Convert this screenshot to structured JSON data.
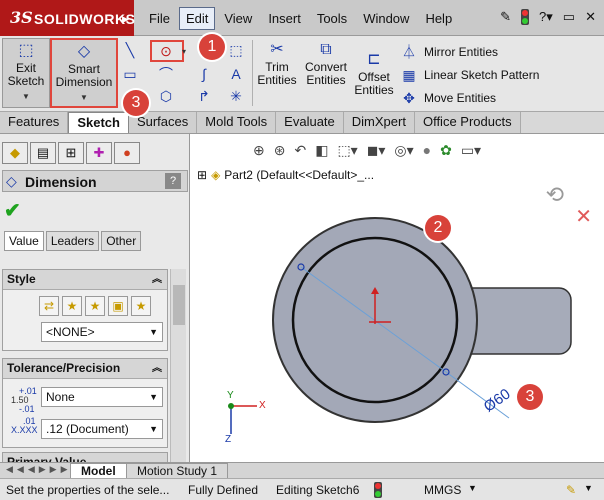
{
  "app": {
    "logo_prefix": "3S",
    "logo_name": "SOLIDWORKS"
  },
  "menu": [
    "File",
    "Edit",
    "View",
    "Insert",
    "Tools",
    "Window",
    "Help"
  ],
  "command_manager": {
    "exit_sketch": "Exit Sketch",
    "smart_dimension": "Smart Dimension",
    "trim_entities": "Trim Entities",
    "convert_entities": "Convert Entities",
    "offset_entities": "Offset Entities",
    "mirror_entities": "Mirror Entities",
    "linear_sketch_pattern": "Linear Sketch Pattern",
    "move_entities": "Move Entities"
  },
  "tabs": [
    "Features",
    "Sketch",
    "Surfaces",
    "Mold Tools",
    "Evaluate",
    "DimXpert",
    "Office Products"
  ],
  "active_tab": "Sketch",
  "property_manager": {
    "title": "Dimension",
    "help": "?",
    "subtabs": [
      "Value",
      "Leaders",
      "Other"
    ],
    "style_group": "Style",
    "style_value": "<NONE>",
    "tolerance_group": "Tolerance/Precision",
    "tolerance_value": "None",
    "tolerance_icon_top": "1.50",
    "tolerance_icon_sup": "+.01",
    "tolerance_icon_sub": "-.01",
    "precision_icon_sup": ".01",
    "precision_icon_main": "X.XXX",
    "precision_value": ".12 (Document)",
    "primary_value_group": "Primary Value"
  },
  "graphics": {
    "tree_label": "Part2  (Default<<Default>_...",
    "dimension_label": "Ø60",
    "axis_x": "X",
    "axis_y": "Y",
    "axis_z": "Z"
  },
  "badges": [
    "1",
    "2",
    "3",
    "3"
  ],
  "bottom_tabs": [
    "Model",
    "Motion Study 1"
  ],
  "status": {
    "message": "Set the properties of the sele...",
    "definition": "Fully Defined",
    "editing": "Editing Sketch6",
    "units": "MMGS"
  },
  "colors": {
    "highlight": "#e0463c",
    "brand": "#b01818",
    "part_fill": "#a3a8b7",
    "sketch_blue": "#1a3aa8"
  }
}
